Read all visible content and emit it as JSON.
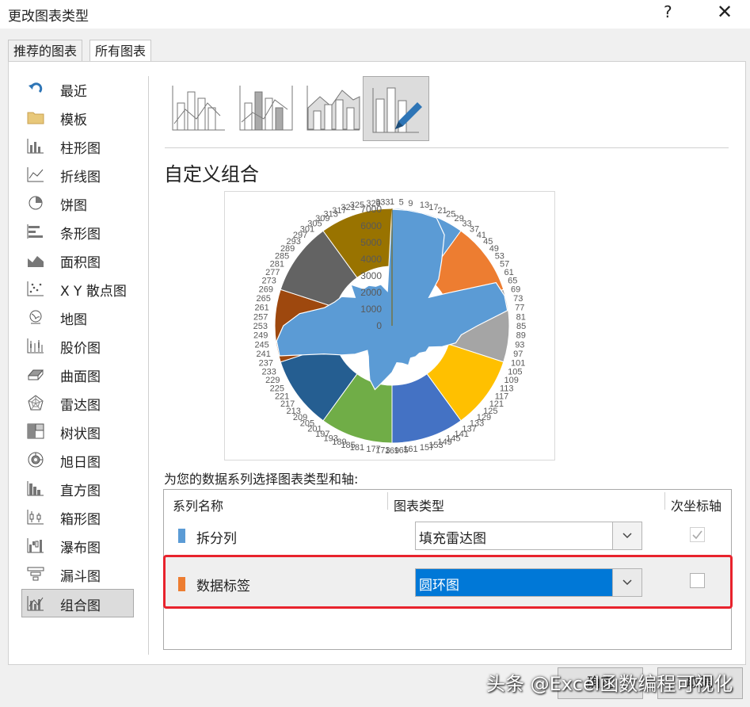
{
  "window": {
    "title": "更改图表类型",
    "help": "?",
    "close": "✕"
  },
  "tabs": [
    {
      "label": "推荐的图表"
    },
    {
      "label": "所有图表"
    }
  ],
  "nav": [
    {
      "label": "最近",
      "icon": "recent-icon"
    },
    {
      "label": "模板",
      "icon": "folder-icon"
    },
    {
      "label": "柱形图",
      "icon": "column-chart-icon"
    },
    {
      "label": "折线图",
      "icon": "line-chart-icon"
    },
    {
      "label": "饼图",
      "icon": "pie-chart-icon"
    },
    {
      "label": "条形图",
      "icon": "bar-chart-icon"
    },
    {
      "label": "面积图",
      "icon": "area-chart-icon"
    },
    {
      "label": "X Y 散点图",
      "icon": "scatter-chart-icon"
    },
    {
      "label": "地图",
      "icon": "map-chart-icon"
    },
    {
      "label": "股价图",
      "icon": "stock-chart-icon"
    },
    {
      "label": "曲面图",
      "icon": "surface-chart-icon"
    },
    {
      "label": "雷达图",
      "icon": "radar-chart-icon"
    },
    {
      "label": "树状图",
      "icon": "treemap-icon"
    },
    {
      "label": "旭日图",
      "icon": "sunburst-icon"
    },
    {
      "label": "直方图",
      "icon": "histogram-icon"
    },
    {
      "label": "箱形图",
      "icon": "box-whisker-icon"
    },
    {
      "label": "瀑布图",
      "icon": "waterfall-icon"
    },
    {
      "label": "漏斗图",
      "icon": "funnel-icon"
    },
    {
      "label": "组合图",
      "icon": "combo-chart-icon"
    }
  ],
  "combo": {
    "title": "自定义组合",
    "instruction": "为您的数据系列选择图表类型和轴:",
    "headers": {
      "name": "系列名称",
      "type": "图表类型",
      "axis": "次坐标轴"
    },
    "rows": [
      {
        "name": "拆分列",
        "type": "填充雷达图",
        "color": "#5b9bd5",
        "secondary": true
      },
      {
        "name": "数据标签",
        "type": "圆环图",
        "color": "#ed7d31",
        "secondary": false
      }
    ]
  },
  "preview": {
    "radial_ticks": [
      "0",
      "1000",
      "2000",
      "3000",
      "4000",
      "5000",
      "6000",
      "7000"
    ],
    "category_labels": [
      "1",
      "5",
      "9",
      "13",
      "17",
      "21",
      "25",
      "29",
      "33",
      "37",
      "41",
      "45",
      "49",
      "53",
      "57",
      "61",
      "65",
      "69",
      "73",
      "77",
      "81",
      "85",
      "89",
      "93",
      "97",
      "101",
      "105",
      "109",
      "113",
      "117",
      "121",
      "125",
      "129",
      "133",
      "137",
      "141",
      "145",
      "149",
      "153",
      "157",
      "161",
      "165",
      "169",
      "173",
      "177",
      "181",
      "185",
      "189",
      "193",
      "197",
      "201",
      "205",
      "209",
      "213",
      "217",
      "221",
      "225",
      "229",
      "233",
      "237",
      "241",
      "245",
      "249",
      "253",
      "257",
      "261",
      "265",
      "269",
      "273",
      "277",
      "281",
      "285",
      "289",
      "293",
      "297",
      "301",
      "305",
      "309",
      "313",
      "317",
      "321",
      "325",
      "329",
      "333"
    ],
    "doughnut_colors": [
      "#5b9bd5",
      "#ed7d31",
      "#a5a5a5",
      "#ffc000",
      "#4472c4",
      "#70ad47",
      "#255e91",
      "#9e480e",
      "#636363",
      "#997300"
    ],
    "radar_color": "#5b9bd5"
  },
  "buttons": {
    "ok": "确定",
    "cancel": "取消"
  },
  "watermark": "头条 @Excel函数编程可视化"
}
